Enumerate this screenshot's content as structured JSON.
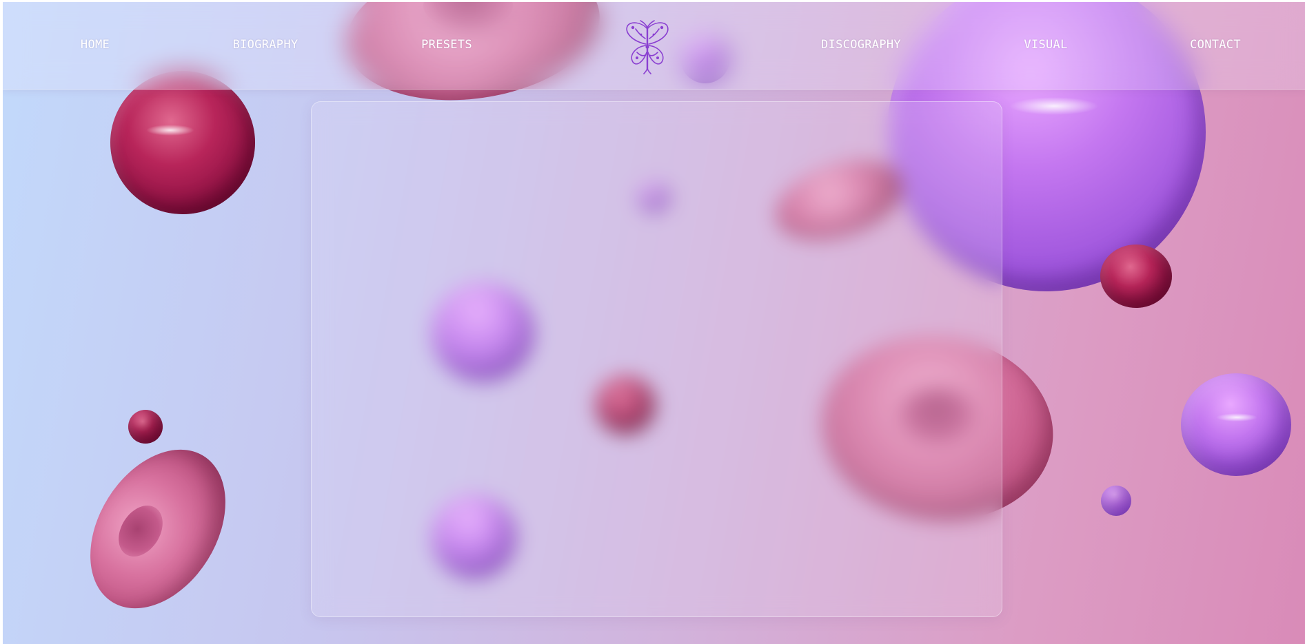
{
  "nav": {
    "items": [
      {
        "label": "HOME"
      },
      {
        "label": "BIOGRAPHY"
      },
      {
        "label": "PRESETS"
      },
      {
        "label": "DISCOGRAPHY"
      },
      {
        "label": "VISUAL"
      },
      {
        "label": "CONTACT"
      }
    ],
    "logo_icon": "butterfly-icon"
  },
  "colors": {
    "nav_text": "#ffffff",
    "logo": "#8a3fd1",
    "background_start": "#c2d9fb",
    "background_end": "#d98bb8"
  }
}
